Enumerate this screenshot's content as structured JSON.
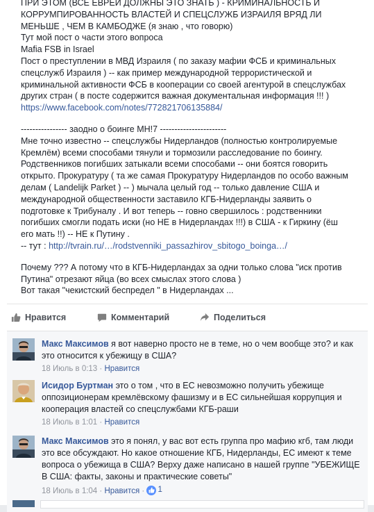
{
  "post": {
    "line_1": "ПРИ ЭТОМ (ВСЕ ЕВРЕИ ДОЛЖНЫ ЭТО ЗНАТЬ ) - КРИМИНАЛЬНОСТЬ И",
    "line_2": "КОРРУМПИРОВАННОСТЬ ВЛАСТЕЙ И СПЕЦСЛУЖБ ИЗРАИЛЯ ВРЯД ЛИ",
    "line_3": "МЕНЬШЕ , ЧЕМ В КАМБОДЖЕ (я знаю , что говорю)",
    "line_4": "Тут мой пост о части этого вопроса",
    "line_5": "Mafia FSB in Israel",
    "line_6": "Пост о преступлении в МВД Израиля ( по заказу мафии ФСБ и криминальных",
    "line_7": "спецслужб Израиля ) -- как пример международной террористической и",
    "line_8": "криминальной активности ФСБ в кооперации со своей агентурой в спецслужбах",
    "line_9": "других стран ( в посте содержится важная документальная информация !!! )",
    "link_1": "https://www.facebook.com/notes/772821706135884/",
    "line_10": "---------------- заодно о боинге МН!7 -----------------------",
    "line_11": "Мне точно известно -- спецслужбы Нидерландов (полностью контролируемые",
    "line_12": "Кремлём) всеми способами тянули и тормозили расследование по боингу.",
    "line_13": "Родственников погибших затыкали всеми способами -- они боятся говорить",
    "line_14": "открыто. Прокуратуру ( та же самая Прокуратуру Нидерландов по особо важным",
    "line_15": "делам ( Landelijk Parket ) -- ) мычала целый год -- только давление США и",
    "line_16": "международной общественности заставило КГБ-Нидерланды заявить о",
    "line_17": "подготовке к Трибуналу . И вот теперь -- говно свершилось : родственники",
    "line_18": "погибших смогли подать иски (но НЕ в Нидерландах !!!) в США - к Гиркину (ёш",
    "line_19": "его мать !!) -- НЕ к Путину .",
    "line_20_prefix": "-- тут : ",
    "link_2": "http://tvrain.ru/…/rodstvenniki_passazhirov_sbitogo_boinga…/",
    "line_21": "Почему ??? А потому что в КГБ-Нидерландах за одни только слова \"иск против",
    "line_22": "Путина\" отрезают яйца (во всех смыслах этого слова )",
    "line_23": "Вот такая \"чекистский беспредел \" в Нидерландах ..."
  },
  "actions": {
    "like": "Нравится",
    "comment": "Комментарий",
    "share": "Поделиться"
  },
  "comments": [
    {
      "author": "Макс Максимов",
      "text": "я вот наверно просто не в теме, но о чем вообще это? и как это относится к убежищу в США?",
      "date": "18 Июль в 0:13",
      "like": "Нравится"
    },
    {
      "author": "Исидор Буртман",
      "text": "это о том , что в ЕС невозможно получить убежище оппозиционерам кремлёвскому фашизму и в ЕС сильнейшая коррупция и кооперация властей со спецслужбами КГБ-раши",
      "date": "18 Июль в 1:01",
      "like": "Нравится"
    },
    {
      "author": "Макс Максимов",
      "text": "это я понял, у вас вот есть группа про мафию кгб, там люди это все обсуждают. Но какое отношение КГБ, Нидерланды, ЕС имеют к теме вопроса о убежища в США? Верху даже написано в нашей группе \"УБЕЖИЩЕ В США: факты, законы и практические советы\"",
      "date": "18 Июль в 1:04",
      "like": "Нравится",
      "like_count": "1"
    }
  ],
  "meta_separator": " · ",
  "colors": {
    "link": "#365899",
    "text": "#1d2129",
    "meta": "#90949c",
    "like_badge": "#5890ff"
  }
}
